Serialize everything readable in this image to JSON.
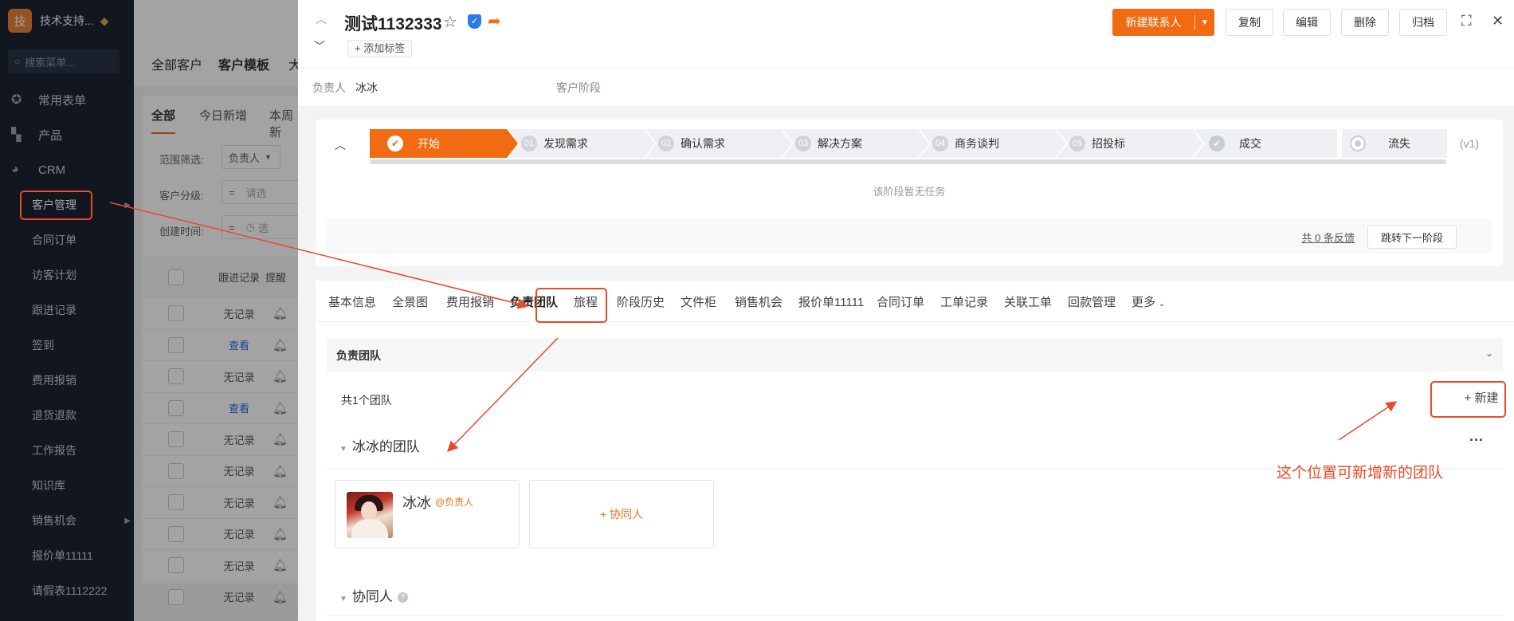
{
  "sidebar": {
    "logo_char": "技",
    "org_name": "技术支持...",
    "search_placeholder": "搜索菜单...",
    "groups": [
      {
        "label": "常用表单",
        "icon": "star-circle-icon"
      },
      {
        "label": "产品",
        "icon": "cubes-icon"
      },
      {
        "label": "CRM",
        "icon": "pie-chart-icon"
      }
    ],
    "items": [
      "客户管理",
      "合同订单",
      "访客计划",
      "跟进记录",
      "签到",
      "费用报销",
      "退货退款",
      "工作报告",
      "知识库",
      "销售机会",
      "报价单11111",
      "请假表1112222"
    ]
  },
  "bg_page": {
    "tabs": [
      "全部客户",
      "客户模板",
      "大"
    ],
    "subtabs": [
      "全部",
      "今日新增",
      "本周新"
    ],
    "filter_scope_label": "范围筛选:",
    "filter_scope_value": "负责人",
    "filter_level_label": "客户分级:",
    "filter_level_placeholder": "请选",
    "filter_time_label": "创建时间:",
    "filter_time_placeholder": "选",
    "table_headers": [
      "跟进记录",
      "提醒"
    ],
    "rows": [
      "无记录",
      "查看",
      "无记录",
      "查看",
      "无记录",
      "无记录",
      "无记录",
      "无记录",
      "无记录",
      "无记录"
    ]
  },
  "drawer": {
    "title": "测试1132333",
    "add_tag": "+ 添加标签",
    "buttons": {
      "new_contact": "新建联系人",
      "copy": "复制",
      "edit": "编辑",
      "delete": "删除",
      "archive": "归档"
    },
    "meta": {
      "owner_label": "负责人",
      "owner_value": "冰冰",
      "stage_label": "客户阶段"
    },
    "stages": [
      {
        "num": "",
        "label": "开始",
        "status": "active"
      },
      {
        "num": "01",
        "label": "发现需求",
        "status": "pending"
      },
      {
        "num": "02",
        "label": "确认需求",
        "status": "pending"
      },
      {
        "num": "03",
        "label": "解决方案",
        "status": "pending"
      },
      {
        "num": "04",
        "label": "商务谈判",
        "status": "pending"
      },
      {
        "num": "05",
        "label": "招投标",
        "status": "pending"
      },
      {
        "num": "",
        "label": "成交",
        "status": "won"
      },
      {
        "num": "",
        "label": "流失",
        "status": "lost"
      }
    ],
    "stage_version": "(v1)",
    "no_task_text": "该阶段暂无任务",
    "feedback_text": "共 0 条反馈",
    "next_stage_button": "跳转下一阶段",
    "tabs": [
      "基本信息",
      "全景图",
      "费用报销",
      "负责团队",
      "旅程",
      "阶段历史",
      "文件柜",
      "销售机会",
      "报价单11111",
      "合同订单",
      "工单记录",
      "关联工单",
      "回款管理",
      "更多"
    ],
    "active_tab": "负责团队",
    "section_title": "负责团队",
    "team_count": "共1个团队",
    "new_team_button": "+ 新建",
    "team_name": "冰冰的团队",
    "member": {
      "name": "冰冰",
      "role": "@负责人"
    },
    "add_collaborator": "+ 协同人",
    "collaborators_heading": "协同人",
    "help_glyph": "?"
  },
  "annotation": {
    "text": "这个位置可新增新的团队",
    "color": "#e84a2a"
  },
  "colors": {
    "accent": "#f26b12",
    "sidebar_bg": "#1c2333",
    "annotation": "#e84a2a"
  }
}
